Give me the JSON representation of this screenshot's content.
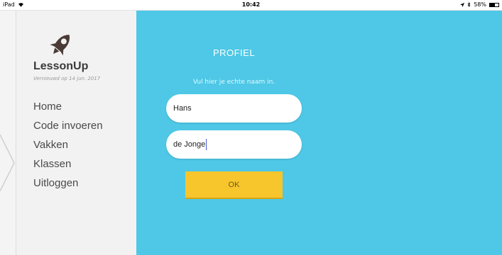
{
  "status_bar": {
    "device": "iPad",
    "time": "10:42",
    "battery": "58%",
    "battery_level": 0.58
  },
  "sidebar": {
    "brand": "LessonUp",
    "updated": "Vernieuwd op 14 jun. 2017",
    "items": [
      {
        "label": "Home"
      },
      {
        "label": "Code invoeren"
      },
      {
        "label": "Vakken"
      },
      {
        "label": "Klassen"
      },
      {
        "label": "Uitloggen"
      }
    ]
  },
  "main": {
    "title": "PROFIEL",
    "hint": "Vul hier je echte naam in.",
    "first_name": "Hans",
    "last_name": "de Jonge",
    "ok_label": "OK"
  },
  "colors": {
    "main_background": "#4ec8e6",
    "button": "#f7c52c",
    "sidebar": "#f2f2f2"
  }
}
